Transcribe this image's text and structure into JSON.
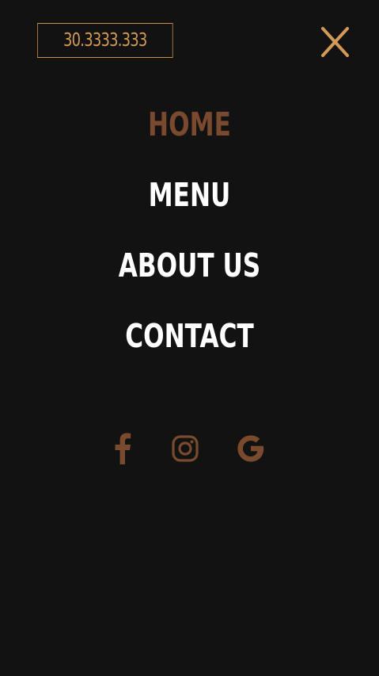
{
  "header": {
    "phone": "30.3333.333",
    "close_icon": "close-x-icon"
  },
  "colors": {
    "background": "#121212",
    "accent_gold": "#d29a56",
    "accent_brown": "#7a4a2e",
    "text": "#ffffff"
  },
  "nav": {
    "items": [
      {
        "label": "HOME",
        "active": true
      },
      {
        "label": "MENU",
        "active": false
      },
      {
        "label": "ABOUT US",
        "active": false
      },
      {
        "label": "CONTACT",
        "active": false
      }
    ]
  },
  "social": {
    "icons": [
      "facebook-icon",
      "instagram-icon",
      "google-icon"
    ]
  }
}
